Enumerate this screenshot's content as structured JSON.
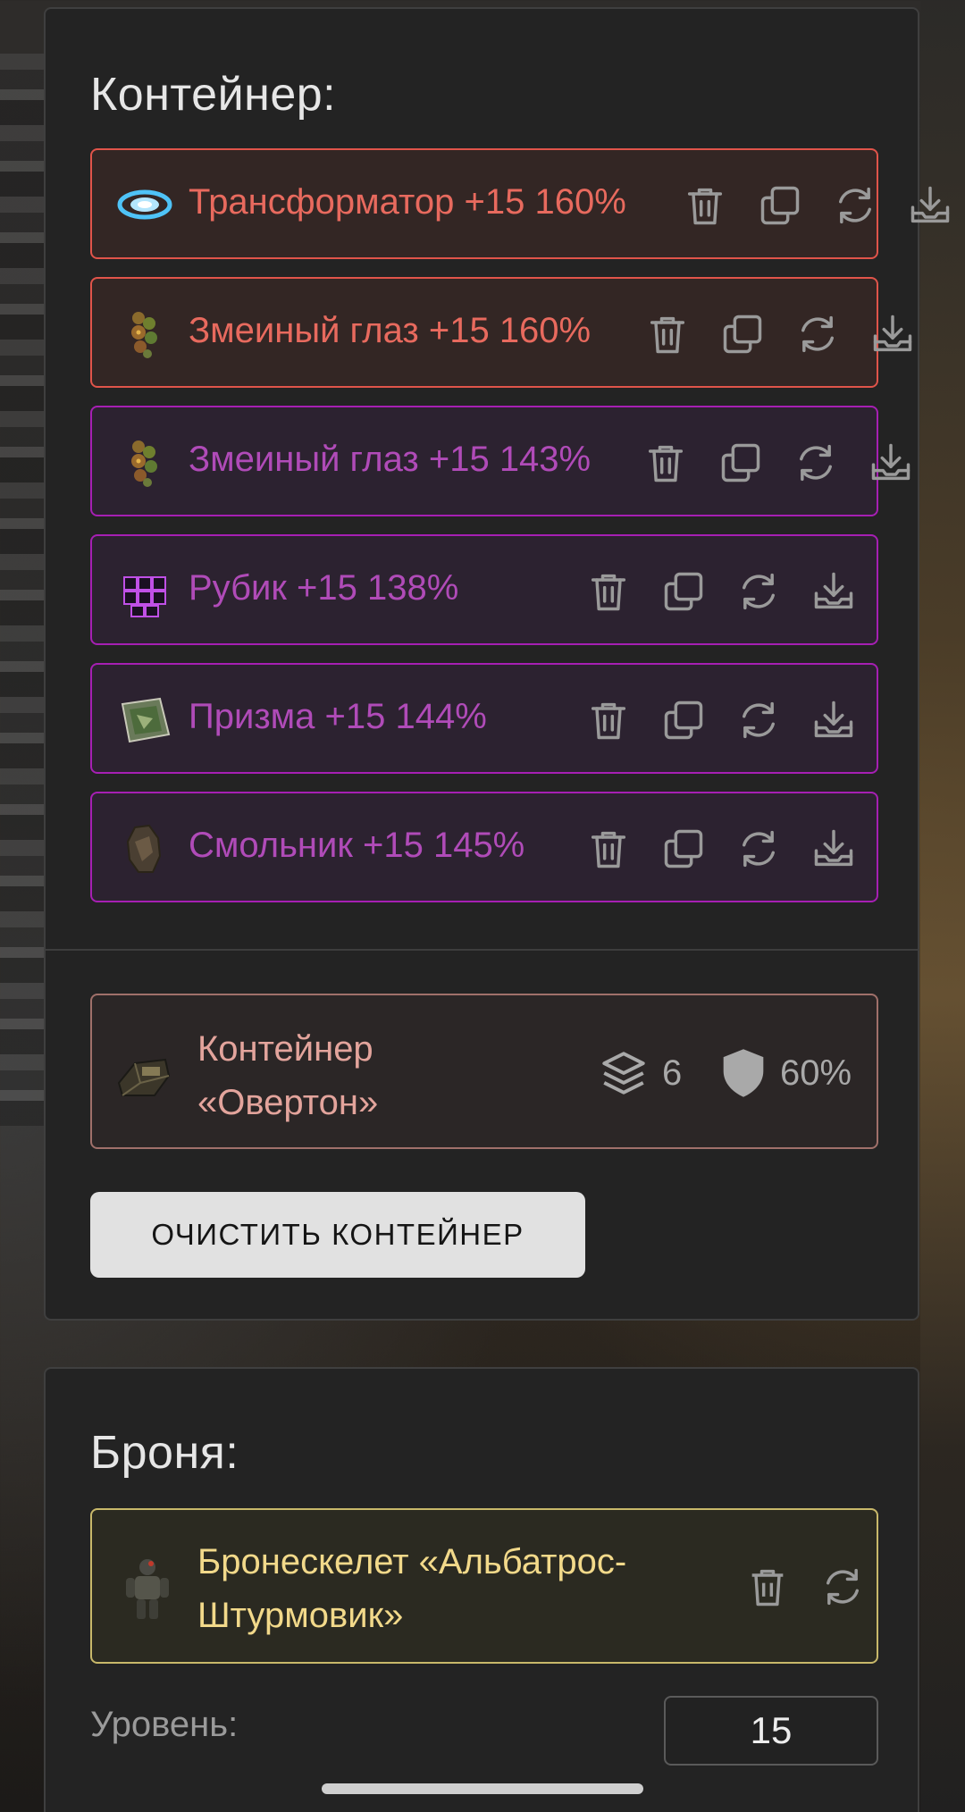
{
  "container": {
    "title": "Контейнер:",
    "items": [
      {
        "label": "Трансформатор +15 160%",
        "rarity": "red",
        "icon": "transformator-artifact-icon"
      },
      {
        "label": "Змеиный глаз +15 160%",
        "rarity": "red",
        "icon": "snake-eye-artifact-icon"
      },
      {
        "label": "Змеиный глаз +15 143%",
        "rarity": "purple",
        "icon": "snake-eye-artifact-icon"
      },
      {
        "label": "Рубик +15 138%",
        "rarity": "purple",
        "icon": "rubik-artifact-icon"
      },
      {
        "label": "Призма +15 144%",
        "rarity": "purple",
        "icon": "prism-artifact-icon"
      },
      {
        "label": "Смольник +15 145%",
        "rarity": "purple",
        "icon": "smolnik-artifact-icon"
      }
    ],
    "actions": [
      "trash-icon",
      "copy-icon",
      "refresh-icon",
      "download-icon"
    ],
    "summary": {
      "name": "Контейнер «Овертон»",
      "slots": "6",
      "protection": "60%"
    },
    "clear_button": "ОЧИСТИТЬ КОНТЕЙНЕР"
  },
  "armor": {
    "title": "Броня:",
    "item_name": "Бронескелет «Альбатрос-Штурмовик»",
    "level_label": "Уровень:",
    "level_value": "15"
  },
  "colors": {
    "red_rarity": "#e0544a",
    "purple_rarity": "#a61fb3",
    "gold_rarity": "#c8b86a",
    "panel_bg": "#232323"
  }
}
